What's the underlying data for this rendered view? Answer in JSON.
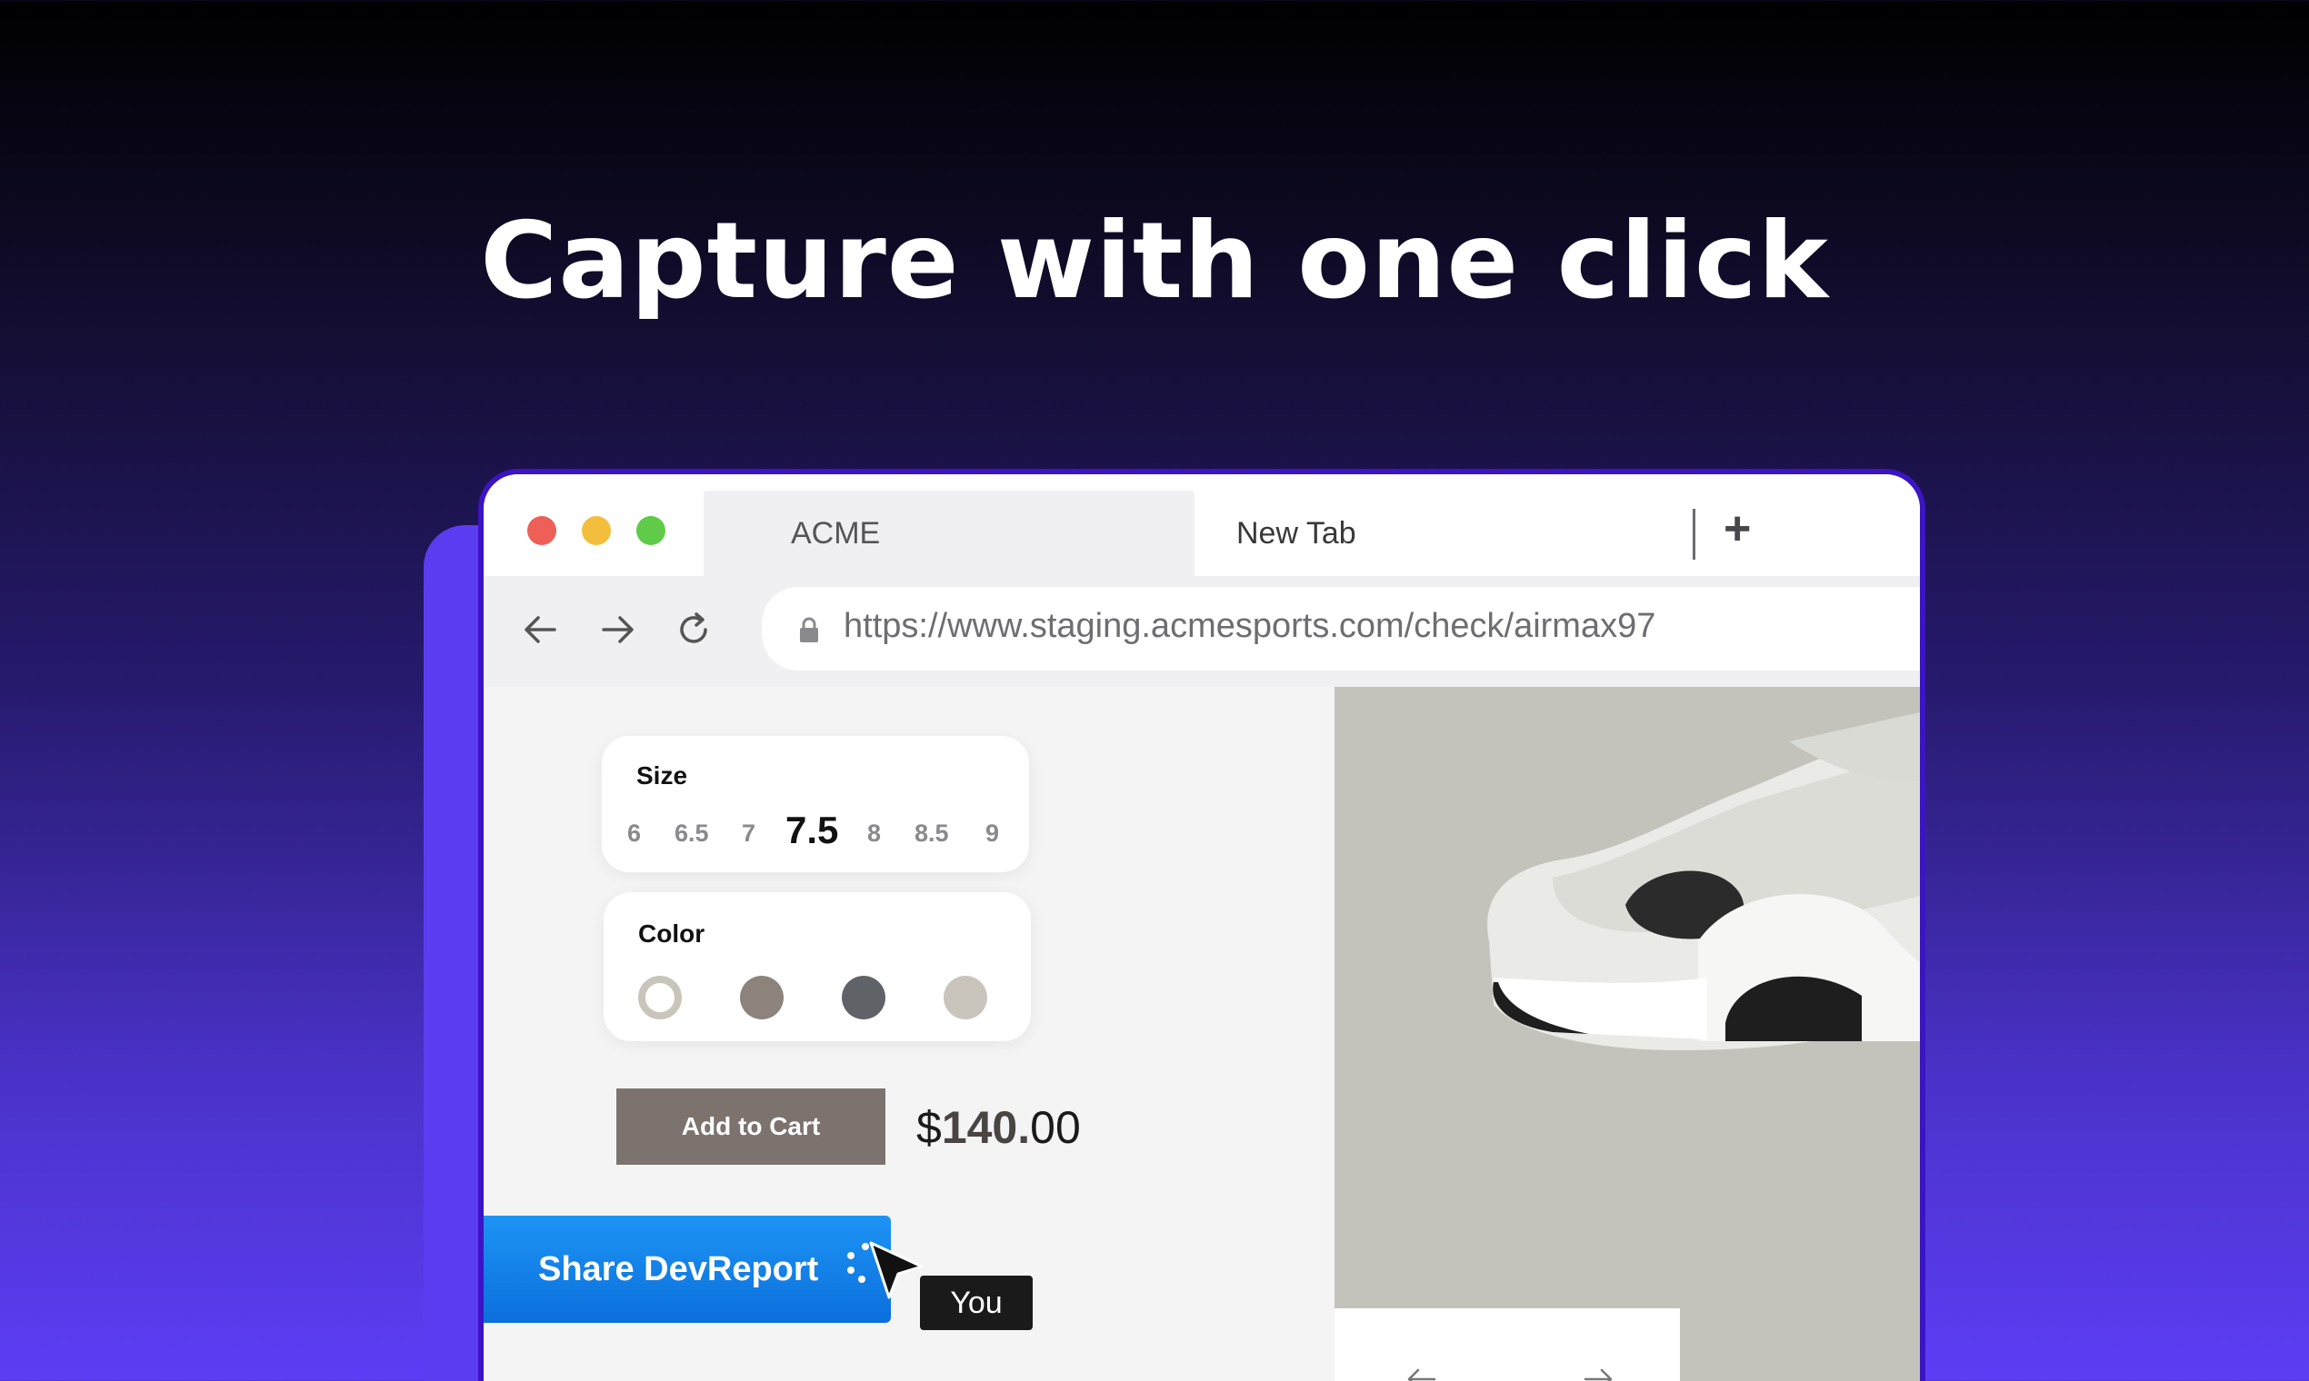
{
  "headline": "Capture with one click",
  "browser": {
    "tabs": [
      {
        "label": "ACME",
        "active": true
      },
      {
        "label": "New Tab",
        "active": false
      }
    ],
    "new_tab_icon": "plus-icon",
    "url": "https://www.staging.acmesports.com/check/airmax97",
    "nav_icons": [
      "back-arrow-icon",
      "forward-arrow-icon",
      "reload-icon",
      "lock-icon"
    ]
  },
  "product": {
    "size": {
      "title": "Size",
      "options": [
        "6",
        "6.5",
        "7",
        "7.5",
        "8",
        "8.5",
        "9"
      ],
      "selected": "7.5"
    },
    "color": {
      "title": "Color",
      "swatches": [
        "#ffffff",
        "#8d837d",
        "#5f6367",
        "#c9c5bc"
      ],
      "selected_index": 0
    },
    "add_to_cart_label": "Add to Cart",
    "price": {
      "currency": "$",
      "whole": "140",
      "sep": ".",
      "cents": "00"
    }
  },
  "devreport": {
    "share_label": "Share DevReport",
    "cursor_label": "You",
    "accent": "#0b6fdc"
  },
  "carousel_icons": [
    "chevron-left-icon",
    "chevron-right-icon"
  ],
  "colors": {
    "brand_purple": "#5d3df5",
    "browser_border": "#3b14c4"
  }
}
